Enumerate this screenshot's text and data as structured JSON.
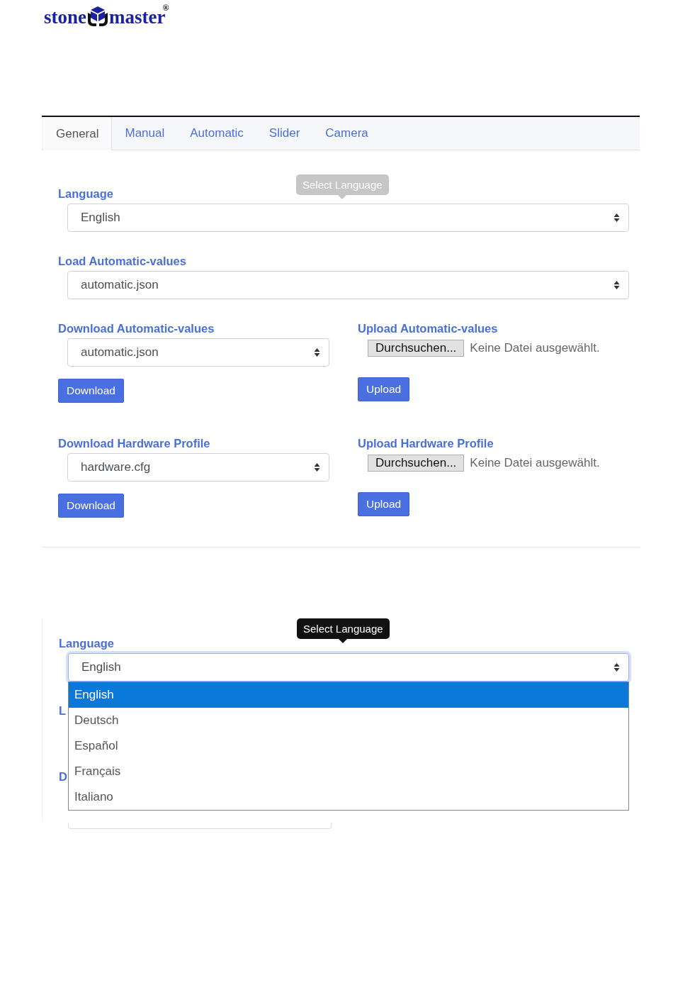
{
  "logo": {
    "left": "stone",
    "right": "master",
    "mark": "®"
  },
  "tabs": [
    {
      "label": "General",
      "selected": true
    },
    {
      "label": "Manual",
      "selected": false
    },
    {
      "label": "Automatic",
      "selected": false
    },
    {
      "label": "Slider",
      "selected": false
    },
    {
      "label": "Camera",
      "selected": false
    }
  ],
  "settings": {
    "language": {
      "label": "Language",
      "value": "English",
      "tooltip": {
        "text": "Select Language",
        "faded": true
      }
    },
    "load_automatic": {
      "label": "Load Automatic-values",
      "value": "automatic.json"
    },
    "pairs": [
      {
        "download": {
          "label": "Download Automatic-values",
          "value": "automatic.json",
          "button": "Download"
        },
        "upload": {
          "label": "Upload Automatic-values",
          "browse": "Durchsuchen...",
          "file_status": "Keine Datei ausgewählt.",
          "button": "Upload"
        }
      },
      {
        "download": {
          "label": "Download Hardware Profile",
          "value": "hardware.cfg",
          "button": "Download"
        },
        "upload": {
          "label": "Upload Hardware Profile",
          "browse": "Durchsuchen...",
          "file_status": "Keine Datei ausgewählt.",
          "button": "Upload"
        }
      }
    ]
  },
  "dropdown_view": {
    "label": "Language",
    "value": "English",
    "focused": true,
    "tooltip": {
      "text": "Select Language",
      "faded": false
    },
    "options": [
      {
        "label": "English",
        "selected": true
      },
      {
        "label": "Deutsch",
        "selected": false
      },
      {
        "label": "Español",
        "selected": false
      },
      {
        "label": "Français",
        "selected": false
      },
      {
        "label": "Italiano",
        "selected": false
      }
    ],
    "covered_labels": [
      "L",
      "D"
    ]
  }
}
